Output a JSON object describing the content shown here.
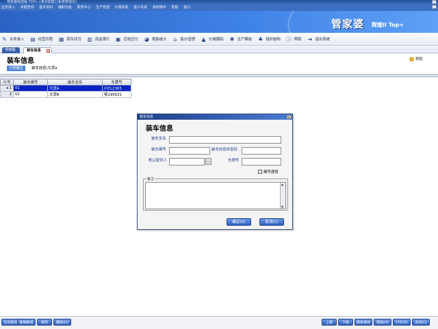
{
  "window": {
    "title": "管家婆辉煌版 TOP+ [演示账套] [系统管理员]"
  },
  "menu": [
    "业务录入",
    "单据查询",
    "基本资料",
    "辅助功能",
    "报表中心",
    "生产管理",
    "价格体系",
    "客户关系",
    "系统维护",
    "帮助",
    "窗口"
  ],
  "banner": {
    "brand": "管家婆",
    "edition": "辉煌II Top+"
  },
  "toolbar": {
    "items": [
      {
        "label": "业务录入",
        "icon": "edit-icon"
      },
      {
        "label": "经营历程",
        "icon": "chart-icon"
      },
      {
        "label": "库存状况",
        "icon": "box-icon"
      },
      {
        "label": "现金银行",
        "icon": "bank-icon"
      },
      {
        "label": "应收应付",
        "icon": "ledger-icon"
      },
      {
        "label": "销售统计",
        "icon": "pie-icon"
      },
      {
        "label": "售价管理",
        "icon": "tag-icon"
      },
      {
        "label": "价格跟踪",
        "icon": "trend-icon"
      },
      {
        "label": "生产模板",
        "icon": "gear-icon"
      },
      {
        "label": "组织结构",
        "icon": "org-icon"
      },
      {
        "label": "帮助",
        "icon": "info-icon"
      },
      {
        "label": "退出系统",
        "icon": "exit-icon"
      }
    ]
  },
  "tabs": {
    "nav": "导航图",
    "current": "装车信息"
  },
  "page": {
    "title": "装车信息",
    "help": "帮助",
    "crumb_badge": "分类路径",
    "crumb_path": "装车信息\\大货a"
  },
  "grid": {
    "columns": [
      "行号",
      "装车编号",
      "装车全名",
      "车牌号"
    ],
    "rows": [
      {
        "no": "1",
        "code": "01",
        "name": "大货A",
        "plate": "川CL2365",
        "selected": true
      },
      {
        "no": "2",
        "code": "02",
        "name": "大货B",
        "plate": "鄂195631",
        "selected": false
      }
    ]
  },
  "dialog": {
    "window_title": "装车信息",
    "heading": "装车信息",
    "fields": {
      "full_name_label": "装车全名",
      "full_name_value": "",
      "code_label": "装车编号",
      "code_value": "",
      "pinyin_label": "装车信息拼音码",
      "pinyin_value": "",
      "dispatcher_label": "默认配货人",
      "dispatcher_value": "",
      "plate_label": "车牌号",
      "plate_value": ""
    },
    "auto_code_label": "编号递增",
    "memo_label": "备注",
    "ok_label": "确定(O)",
    "cancel_label": "取消(C)"
  },
  "bottom_buttons": {
    "left": [
      "空白新增",
      "复制新增",
      "修改",
      "删除(D)"
    ],
    "right": [
      "上移",
      "下移",
      "排序保存",
      "帮助(H)",
      "打印(P)",
      "关闭(C)"
    ]
  }
}
